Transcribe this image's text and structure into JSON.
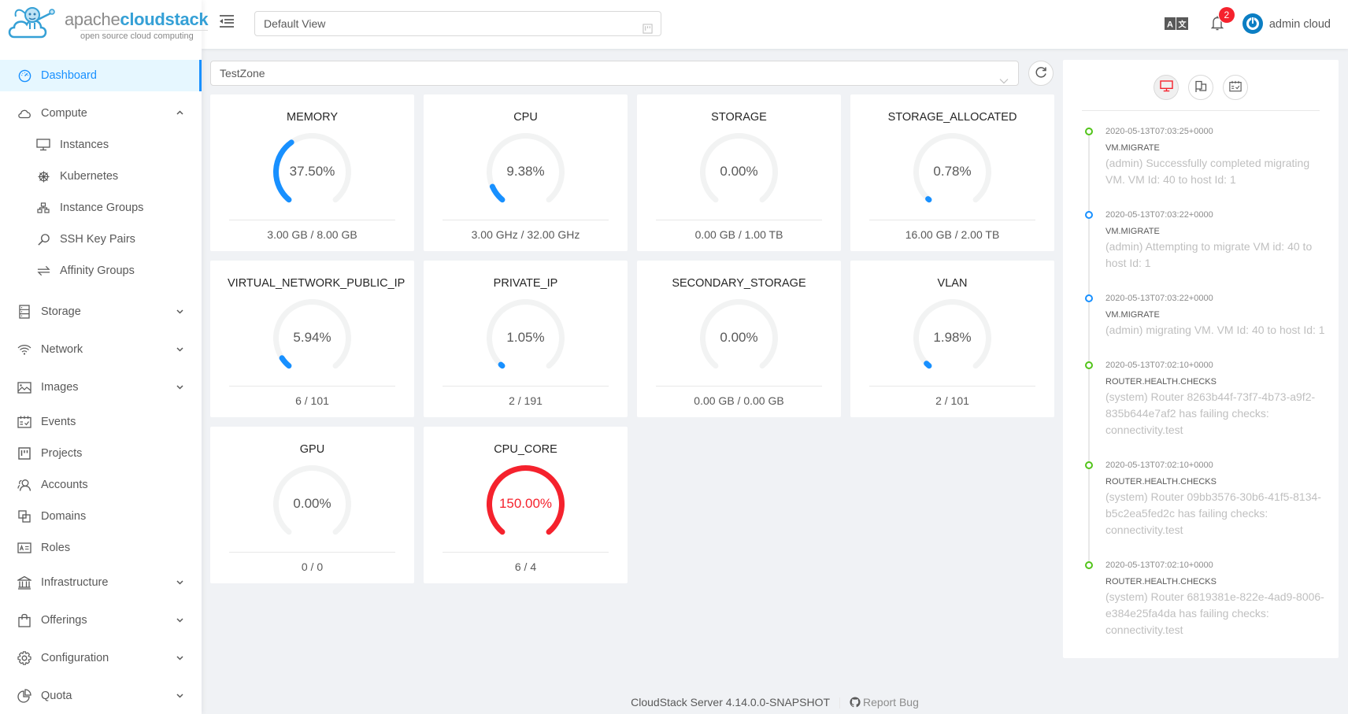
{
  "brand": {
    "name_part1": "apache",
    "name_part2": "cloudstack",
    "tagline": "open source cloud computing"
  },
  "sidebar": {
    "items": [
      {
        "label": "Dashboard",
        "icon": "dashboard-icon",
        "active": true
      },
      {
        "label": "Compute",
        "icon": "cloud-icon",
        "expanded": true,
        "children": [
          {
            "label": "Instances",
            "icon": "desktop-icon"
          },
          {
            "label": "Kubernetes",
            "icon": "kubernetes-icon"
          },
          {
            "label": "Instance Groups",
            "icon": "cluster-icon"
          },
          {
            "label": "SSH Key Pairs",
            "icon": "key-icon"
          },
          {
            "label": "Affinity Groups",
            "icon": "swap-icon"
          }
        ]
      },
      {
        "label": "Storage",
        "icon": "database-icon",
        "expandable": true
      },
      {
        "label": "Network",
        "icon": "wifi-icon",
        "expandable": true
      },
      {
        "label": "Images",
        "icon": "picture-icon",
        "expandable": true
      },
      {
        "label": "Events",
        "icon": "schedule-icon"
      },
      {
        "label": "Projects",
        "icon": "project-icon"
      },
      {
        "label": "Accounts",
        "icon": "team-icon"
      },
      {
        "label": "Domains",
        "icon": "block-icon"
      },
      {
        "label": "Roles",
        "icon": "idcard-icon"
      },
      {
        "label": "Infrastructure",
        "icon": "bank-icon",
        "expandable": true
      },
      {
        "label": "Offerings",
        "icon": "shopping-icon",
        "expandable": true
      },
      {
        "label": "Configuration",
        "icon": "setting-icon",
        "expandable": true
      },
      {
        "label": "Quota",
        "icon": "pie-chart-icon",
        "expandable": true
      }
    ]
  },
  "header": {
    "view_select": "Default View",
    "notification_count": "2",
    "user_name": "admin cloud"
  },
  "zone": {
    "selected": "TestZone"
  },
  "capacity": [
    {
      "title": "MEMORY",
      "percent": 37.5,
      "percent_label": "37.50%",
      "usage": "3.00 GB / 8.00 GB"
    },
    {
      "title": "CPU",
      "percent": 9.38,
      "percent_label": "9.38%",
      "usage": "3.00 GHz / 32.00 GHz"
    },
    {
      "title": "STORAGE",
      "percent": 0.0,
      "percent_label": "0.00%",
      "usage": "0.00 GB / 1.00 TB"
    },
    {
      "title": "STORAGE_ALLOCATED",
      "percent": 0.78,
      "percent_label": "0.78%",
      "usage": "16.00 GB / 2.00 TB"
    },
    {
      "title": "VIRTUAL_NETWORK_PUBLIC_IP",
      "percent": 5.94,
      "percent_label": "5.94%",
      "usage": "6 / 101"
    },
    {
      "title": "PRIVATE_IP",
      "percent": 1.05,
      "percent_label": "1.05%",
      "usage": "2 / 191"
    },
    {
      "title": "SECONDARY_STORAGE",
      "percent": 0.0,
      "percent_label": "0.00%",
      "usage": "0.00 GB / 0.00 GB"
    },
    {
      "title": "VLAN",
      "percent": 1.98,
      "percent_label": "1.98%",
      "usage": "2 / 101"
    },
    {
      "title": "GPU",
      "percent": 0.0,
      "percent_label": "0.00%",
      "usage": "0 / 0"
    },
    {
      "title": "CPU_CORE",
      "percent": 150.0,
      "percent_label": "150.00%",
      "usage": "6 / 4"
    }
  ],
  "colors": {
    "accent": "#1890ff",
    "danger": "#f5222d",
    "success": "#52c41a",
    "gauge_track": "#f2f3f3"
  },
  "events_panel": {
    "tabs": [
      {
        "icon": "desktop-icon",
        "active": true
      },
      {
        "icon": "flag-icon",
        "active": false
      },
      {
        "icon": "schedule-icon",
        "active": false
      }
    ],
    "events": [
      {
        "time": "2020-05-13T07:03:25+0000",
        "type": "VM.MIGRATE",
        "description": "(admin) Successfully completed migrating VM. VM Id: 40 to host Id: 1",
        "status": "green"
      },
      {
        "time": "2020-05-13T07:03:22+0000",
        "type": "VM.MIGRATE",
        "description": "(admin) Attempting to migrate VM id: 40 to host Id: 1",
        "status": "blue"
      },
      {
        "time": "2020-05-13T07:03:22+0000",
        "type": "VM.MIGRATE",
        "description": "(admin) migrating VM. VM Id: 40 to host Id: 1",
        "status": "blue"
      },
      {
        "time": "2020-05-13T07:02:10+0000",
        "type": "ROUTER.HEALTH.CHECKS",
        "description": "(system) Router 8263b44f-73f7-4b73-a9f2-835b644e7af2 has failing checks: connectivity.test",
        "status": "green"
      },
      {
        "time": "2020-05-13T07:02:10+0000",
        "type": "ROUTER.HEALTH.CHECKS",
        "description": "(system) Router 09bb3576-30b6-41f5-8134-b5c2ea5fed2c has failing checks: connectivity.test",
        "status": "green"
      },
      {
        "time": "2020-05-13T07:02:10+0000",
        "type": "ROUTER.HEALTH.CHECKS",
        "description": "(system) Router 6819381e-822e-4ad9-8006-e384e25fa4da has failing checks: connectivity.test",
        "status": "green"
      }
    ]
  },
  "footer": {
    "version": "CloudStack Server 4.14.0.0-SNAPSHOT",
    "report_bug": "Report Bug"
  }
}
